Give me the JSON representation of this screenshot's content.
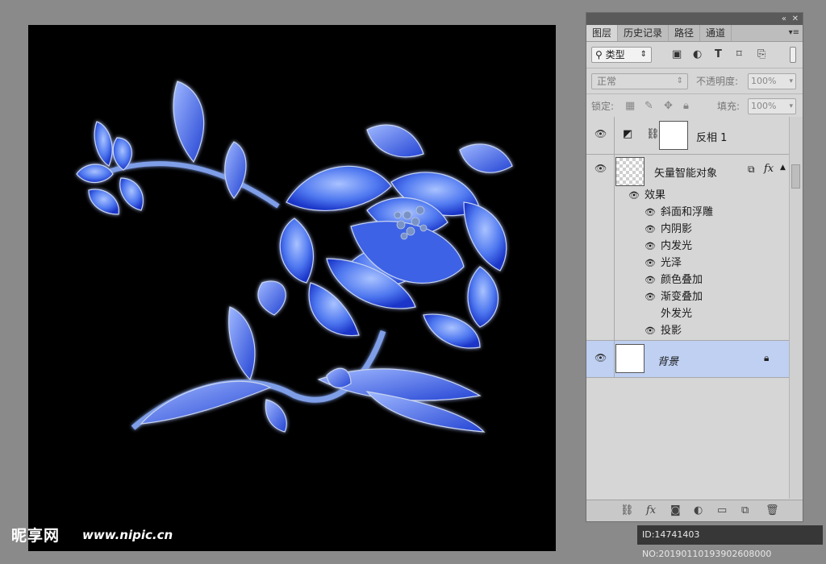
{
  "watermark": {
    "logo": "昵享网",
    "url": "www.nipic.cn",
    "id_text": "ID:14741403 NO:20190110193902608000"
  },
  "panel": {
    "tabs": [
      {
        "label": "图层",
        "active": true
      },
      {
        "label": "历史记录",
        "active": false
      },
      {
        "label": "路径",
        "active": false
      },
      {
        "label": "通道",
        "active": false
      }
    ],
    "filter": {
      "kind_label": "类型",
      "icons": [
        "image-filter-icon",
        "adjustment-filter-icon",
        "type-filter-icon",
        "shape-filter-icon",
        "smart-object-filter-icon"
      ]
    },
    "blend_mode": "正常",
    "opacity_label": "不透明度:",
    "opacity_value": "100%",
    "lock_label": "锁定:",
    "fill_label": "填充:",
    "fill_value": "100%",
    "layers": [
      {
        "name": "反相 1",
        "type": "adjustment"
      },
      {
        "name": "矢量智能对象",
        "type": "smart-object",
        "effects_label": "效果",
        "effects": [
          {
            "name": "斜面和浮雕",
            "visible": true
          },
          {
            "name": "内阴影",
            "visible": true
          },
          {
            "name": "内发光",
            "visible": true
          },
          {
            "name": "光泽",
            "visible": true
          },
          {
            "name": "颜色叠加",
            "visible": true
          },
          {
            "name": "渐变叠加",
            "visible": true
          },
          {
            "name": "外发光",
            "visible": false
          },
          {
            "name": "投影",
            "visible": true
          }
        ]
      },
      {
        "name": "背景",
        "type": "background",
        "selected": true
      }
    ]
  },
  "colors": {
    "canvas": "#000000",
    "flower_light": "#8fb0ff",
    "flower_dark": "#1a35c8",
    "selected_row": "#bfd0f2"
  }
}
